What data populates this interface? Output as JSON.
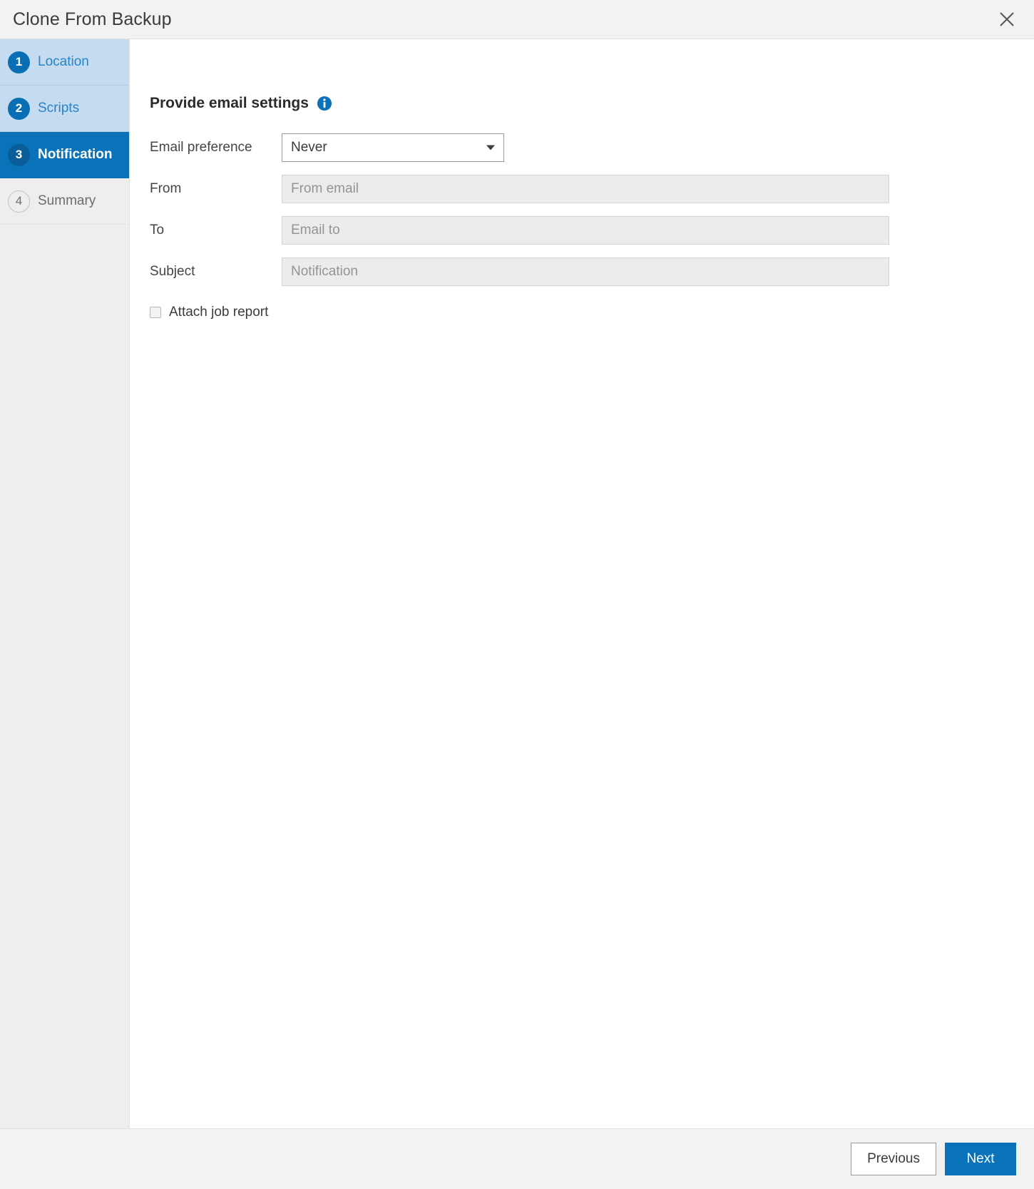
{
  "window": {
    "title": "Clone From Backup",
    "close_icon": "close-icon"
  },
  "sidebar": {
    "steps": [
      {
        "number": "1",
        "label": "Location",
        "state": "done"
      },
      {
        "number": "2",
        "label": "Scripts",
        "state": "done"
      },
      {
        "number": "3",
        "label": "Notification",
        "state": "active"
      },
      {
        "number": "4",
        "label": "Summary",
        "state": "todo"
      }
    ]
  },
  "content": {
    "section_title": "Provide email settings",
    "info_icon": "info-icon",
    "fields": {
      "email_preference": {
        "label": "Email preference",
        "value": "Never",
        "options": [
          "Never"
        ],
        "caret_icon": "chevron-down-icon"
      },
      "from": {
        "label": "From",
        "value": "",
        "placeholder": "From email"
      },
      "to": {
        "label": "To",
        "value": "",
        "placeholder": "Email to"
      },
      "subject": {
        "label": "Subject",
        "value": "",
        "placeholder": "Notification"
      }
    },
    "attach_job_report": {
      "label": "Attach job report",
      "checked": false
    }
  },
  "footer": {
    "previous_label": "Previous",
    "next_label": "Next"
  },
  "colors": {
    "accent": "#0a72b9",
    "step_done_bg": "#c5dbef",
    "step_done_text": "#2784c8",
    "chrome_bg": "#f2f2f2",
    "sidebar_bg": "#eeeeee",
    "disabled_input_bg": "#ececec"
  }
}
